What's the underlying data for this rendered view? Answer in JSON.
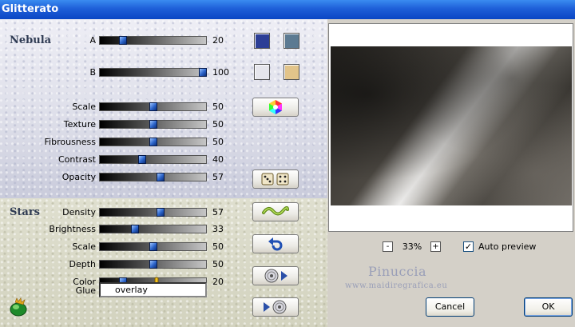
{
  "window": {
    "title": "Glitterato"
  },
  "nebula": {
    "title": "Nebula",
    "sliders": [
      {
        "label": "A",
        "value": "20",
        "fraction": 0.22
      },
      {
        "label": "B",
        "value": "100",
        "fraction": 0.97
      },
      {
        "label": "Scale",
        "value": "50",
        "fraction": 0.5
      },
      {
        "label": "Texture",
        "value": "50",
        "fraction": 0.5
      },
      {
        "label": "Fibrousness",
        "value": "50",
        "fraction": 0.5
      },
      {
        "label": "Contrast",
        "value": "40",
        "fraction": 0.4
      },
      {
        "label": "Opacity",
        "value": "57",
        "fraction": 0.57
      }
    ],
    "swatches": {
      "a1": "#2c3e96",
      "a2": "#5c7a92",
      "b1": "#e6e6ec",
      "b2": "#e2c48a"
    }
  },
  "stars": {
    "title": "Stars",
    "sliders": [
      {
        "label": "Density",
        "value": "57",
        "fraction": 0.57
      },
      {
        "label": "Brightness",
        "value": "33",
        "fraction": 0.33
      },
      {
        "label": "Scale",
        "value": "50",
        "fraction": 0.5
      },
      {
        "label": "Depth",
        "value": "50",
        "fraction": 0.5
      },
      {
        "label": "Color",
        "value": "20",
        "fraction": 0.22
      }
    ],
    "glue": {
      "label": "Glue",
      "value": "overlay"
    }
  },
  "icons": [
    "color-wheel-icon",
    "dice-icon",
    "wave-icon",
    "undo-icon",
    "cd-play-icon",
    "cd-next-icon",
    "app-logo-icon",
    "hand-pointer-icon"
  ],
  "preview": {
    "zoom_minus": "-",
    "zoom": "33%",
    "zoom_plus": "+",
    "auto_preview_label": "Auto preview",
    "auto_preview_checked": true
  },
  "watermark": {
    "line1": "Pinuccia",
    "line2": "www.maidiregrafica.eu"
  },
  "buttons": {
    "cancel": "Cancel",
    "ok": "OK"
  }
}
